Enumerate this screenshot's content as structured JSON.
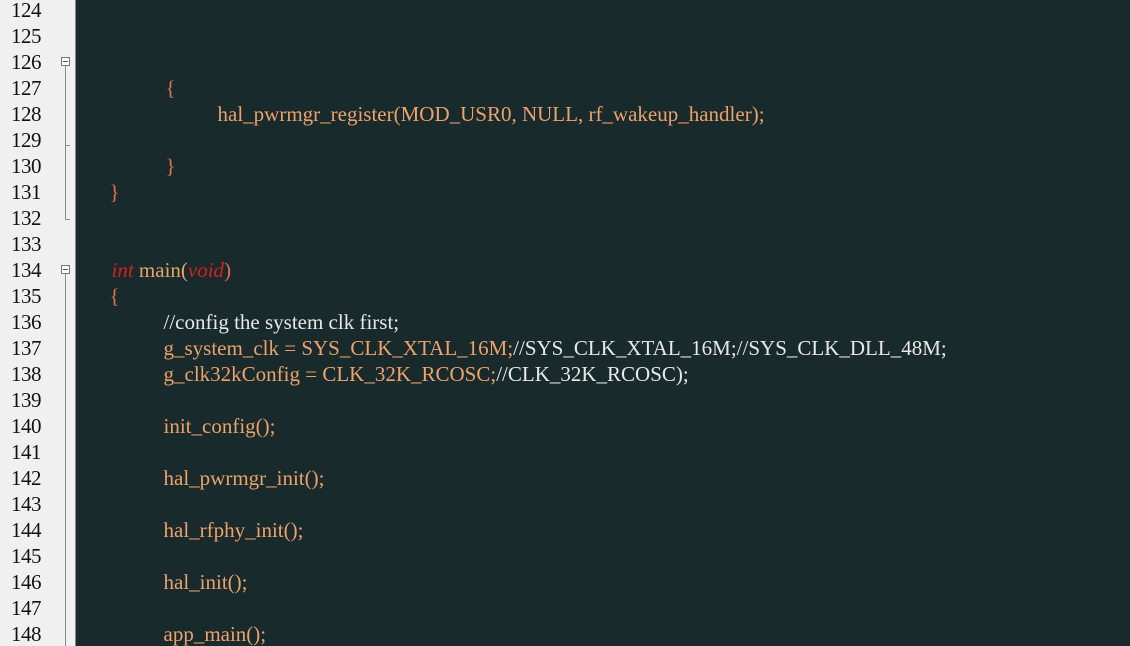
{
  "editor": {
    "line_numbers": [
      "124",
      "125",
      "126",
      "127",
      "128",
      "129",
      "130",
      "131",
      "132",
      "133",
      "134",
      "135",
      "136",
      "137",
      "138",
      "139",
      "140",
      "141",
      "142",
      "143",
      "144",
      "145",
      "146",
      "147",
      "148"
    ],
    "code": {
      "l126_brace": "{",
      "l127_call": "hal_pwrmgr_register(MOD_USR0, NULL, rf_wakeup_handler);",
      "l129_brace": "}",
      "l130_brace": "}",
      "l133_type": "int",
      "l133_name": " main(",
      "l133_param": "void",
      "l133_close": ")",
      "l134_brace": "{",
      "l135_comment": "//config the system clk first;",
      "l136_code": "g_system_clk = SYS_CLK_XTAL_16M;",
      "l136_comment": "//SYS_CLK_XTAL_16M;//SYS_CLK_DLL_48M;",
      "l137_code": "g_clk32kConfig = CLK_32K_RCOSC;",
      "l137_comment": "//CLK_32K_RCOSC);",
      "l139": "init_config();",
      "l141": "hal_pwrmgr_init();",
      "l143": "hal_rfphy_init();",
      "l145": "hal_init();",
      "l147": "app_main();",
      "l148_brace": "}"
    },
    "colors": {
      "background": "#182a2c",
      "gutter": "#f0f0f0",
      "identifier": "#eda26b",
      "keyword": "#d0221e",
      "comment": "#e8e8e8"
    }
  }
}
